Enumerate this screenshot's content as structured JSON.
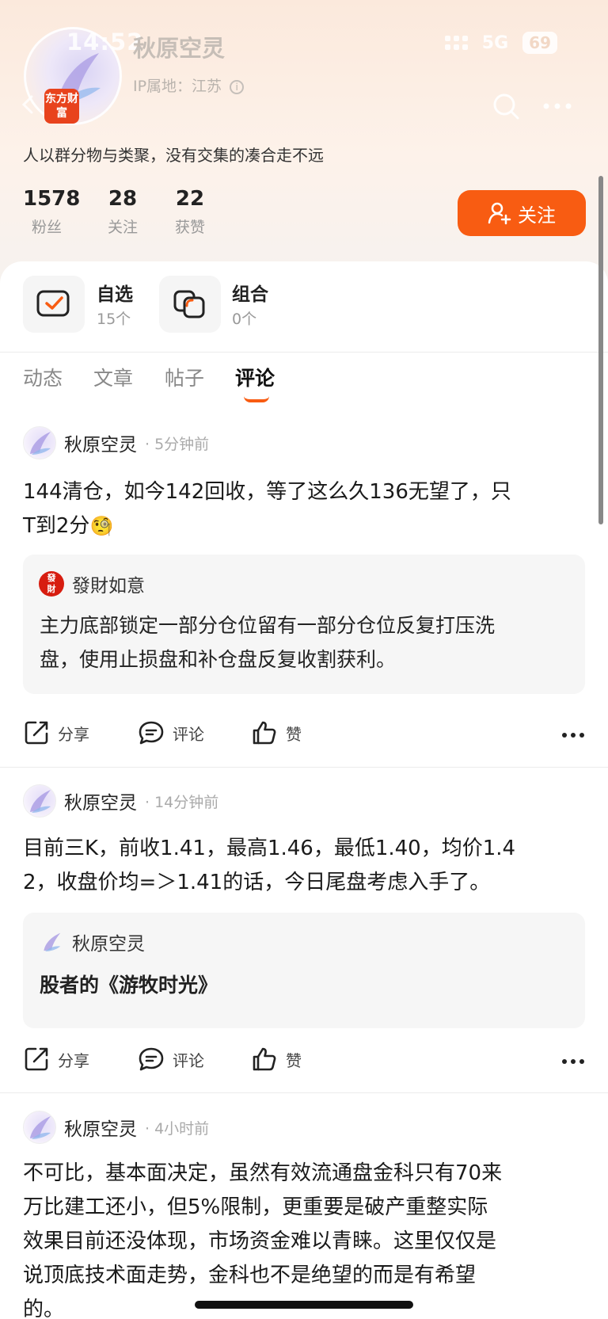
{
  "status_bar": {
    "time": "14:52",
    "network": "5G",
    "battery": "69"
  },
  "profile": {
    "brand_badge": "东方财富",
    "name": "秋原空灵",
    "ip_location": "IP属地：江苏",
    "bio": "人以群分物与类聚，没有交集的凑合走不远",
    "stats": [
      {
        "num": "1578",
        "label": "粉丝"
      },
      {
        "num": "28",
        "label": "关注"
      },
      {
        "num": "22",
        "label": "获赞"
      }
    ],
    "follow_label": "关注"
  },
  "quick": [
    {
      "title": "自选",
      "sub": "15个"
    },
    {
      "title": "组合",
      "sub": "0个"
    }
  ],
  "tabs": [
    "动态",
    "文章",
    "帖子",
    "评论"
  ],
  "action_labels": {
    "share": "分享",
    "comment": "评论",
    "like": "赞"
  },
  "posts": [
    {
      "author": "秋原空灵",
      "time": "· 5分钟前",
      "lines": [
        "144清仓，如今142回收，等了这么久136无望了，只",
        "T到2分"
      ],
      "emoji": "🧐",
      "quote_author": "發財如意",
      "quote_lines": [
        "主力底部锁定一部分仓位留有一部分仓位反复打压洗",
        "盘，使用止损盘和补仓盘反复收割获利。"
      ]
    },
    {
      "author": "秋原空灵",
      "time": "· 14分钟前",
      "lines": [
        "目前三K，前收1.41，最高1.46，最低1.40，均价1.4",
        "2，收盘价均=＞1.41的话，今日尾盘考虑入手了。"
      ],
      "quote_author": "秋原空灵",
      "quote_title": "股者的《游牧时光》"
    },
    {
      "author": "秋原空灵",
      "time": "· 4小时前",
      "lines": [
        "不可比，基本面决定，虽然有效流通盘金科只有70来",
        "万比建工还小，但5%限制，更重要是破产重整实际",
        "效果目前还没体现，市场资金难以青睐。这里仅仅是",
        "说顶底技术面走势，金科也不是绝望的而是有希望",
        "的。"
      ]
    }
  ]
}
